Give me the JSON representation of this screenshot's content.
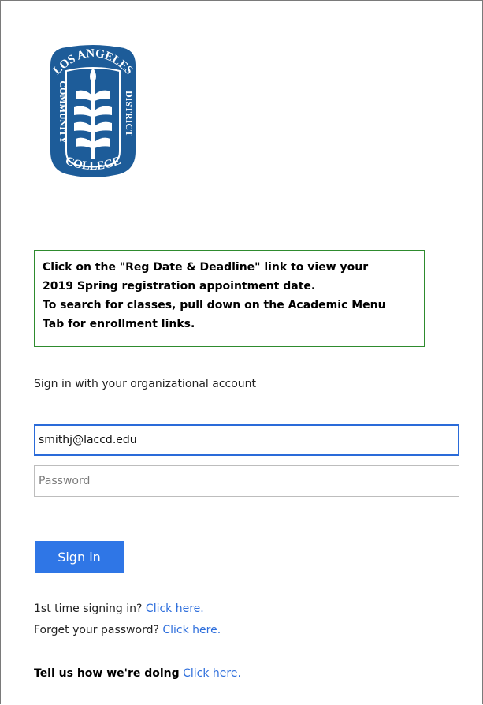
{
  "logo": {
    "text_top": "LOS ANGELES",
    "text_left": "COMMUNITY",
    "text_bottom": "COLLEGE",
    "text_right": "DISTRICT",
    "color": "#1d5c99"
  },
  "notice": {
    "lines": [
      "Click on the \"Reg Date & Deadline\" link to view your",
      "2019 Spring registration appointment date.",
      "To search for classes, pull down on the Academic Menu",
      "Tab for enrollment links."
    ],
    "border_color": "#2e8b2e"
  },
  "signin_form": {
    "subtitle": "Sign in with your organizational account",
    "username_value": "smithj@laccd.edu",
    "password_placeholder": "Password",
    "signin_label": "Sign in",
    "button_color": "#2f76e6"
  },
  "help": {
    "first_time_text": "1st time signing in?",
    "first_time_link": "Click here.",
    "forgot_text": "Forget your password?",
    "forgot_link": "Click here.",
    "feedback_text": "Tell us how we're doing",
    "feedback_link": "Click here.",
    "link_color": "#2f6fdc"
  }
}
